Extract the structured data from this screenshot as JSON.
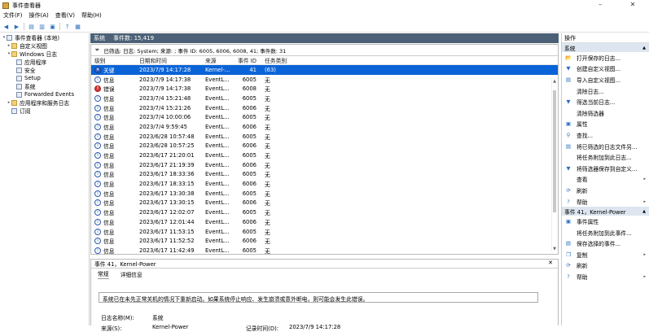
{
  "window": {
    "title": "事件查看器",
    "minimize": "–",
    "close": "✕"
  },
  "menu": [
    "文件(F)",
    "操作(A)",
    "查看(V)",
    "帮助(H)"
  ],
  "tree": [
    {
      "label": "事件查看器 (本地)",
      "level": 0,
      "expander": "▾",
      "icon": "computer-icon"
    },
    {
      "label": "自定义视图",
      "level": 1,
      "expander": "▸",
      "icon": "folder-icon"
    },
    {
      "label": "Windows 日志",
      "level": 1,
      "expander": "▾",
      "icon": "folder-icon"
    },
    {
      "label": "应用程序",
      "level": 2,
      "expander": "",
      "icon": "log-icon"
    },
    {
      "label": "安全",
      "level": 2,
      "expander": "",
      "icon": "log-icon"
    },
    {
      "label": "Setup",
      "level": 2,
      "expander": "",
      "icon": "log-icon"
    },
    {
      "label": "系统",
      "level": 2,
      "expander": "",
      "icon": "log-icon"
    },
    {
      "label": "Forwarded Events",
      "level": 2,
      "expander": "",
      "icon": "log-icon"
    },
    {
      "label": "应用程序和服务日志",
      "level": 1,
      "expander": "▸",
      "icon": "folder-icon"
    },
    {
      "label": "订阅",
      "level": 1,
      "expander": "",
      "icon": "log-icon"
    }
  ],
  "center": {
    "header_name": "系统",
    "header_count": "事件数: 15,419",
    "filter_text": "已筛选: 日志: System; 来源: ; 事件 ID: 6005, 6006, 6008, 41; 事件数: 31",
    "columns": [
      "级别",
      "日期和时间",
      "来源",
      "事件 ID",
      "任务类别"
    ],
    "rows": [
      {
        "level": "关键",
        "type": "crit",
        "datetime": "2023/7/9 14:17:28",
        "source": "Kernel-...",
        "id": "41",
        "task": "(63)",
        "selected": true
      },
      {
        "level": "信息",
        "type": "info",
        "datetime": "2023/7/9 14:17:38",
        "source": "EventL...",
        "id": "6005",
        "task": "无"
      },
      {
        "level": "错误",
        "type": "err",
        "datetime": "2023/7/9 14:17:38",
        "source": "EventL...",
        "id": "6008",
        "task": "无"
      },
      {
        "level": "信息",
        "type": "info",
        "datetime": "2023/7/4 15:21:48",
        "source": "EventL...",
        "id": "6005",
        "task": "无"
      },
      {
        "level": "信息",
        "type": "info",
        "datetime": "2023/7/4 15:21:26",
        "source": "EventL...",
        "id": "6006",
        "task": "无"
      },
      {
        "level": "信息",
        "type": "info",
        "datetime": "2023/7/4 10:00:06",
        "source": "EventL...",
        "id": "6005",
        "task": "无"
      },
      {
        "level": "信息",
        "type": "info",
        "datetime": "2023/7/4 9:59:45",
        "source": "EventL...",
        "id": "6006",
        "task": "无"
      },
      {
        "level": "信息",
        "type": "info",
        "datetime": "2023/6/28 10:57:48",
        "source": "EventL...",
        "id": "6005",
        "task": "无"
      },
      {
        "level": "信息",
        "type": "info",
        "datetime": "2023/6/28 10:57:25",
        "source": "EventL...",
        "id": "6006",
        "task": "无"
      },
      {
        "level": "信息",
        "type": "info",
        "datetime": "2023/6/17 21:20:01",
        "source": "EventL...",
        "id": "6005",
        "task": "无"
      },
      {
        "level": "信息",
        "type": "info",
        "datetime": "2023/6/17 21:19:39",
        "source": "EventL...",
        "id": "6006",
        "task": "无"
      },
      {
        "level": "信息",
        "type": "info",
        "datetime": "2023/6/17 18:33:36",
        "source": "EventL...",
        "id": "6005",
        "task": "无"
      },
      {
        "level": "信息",
        "type": "info",
        "datetime": "2023/6/17 18:33:15",
        "source": "EventL...",
        "id": "6006",
        "task": "无"
      },
      {
        "level": "信息",
        "type": "info",
        "datetime": "2023/6/17 13:30:38",
        "source": "EventL...",
        "id": "6005",
        "task": "无"
      },
      {
        "level": "信息",
        "type": "info",
        "datetime": "2023/6/17 13:30:15",
        "source": "EventL...",
        "id": "6006",
        "task": "无"
      },
      {
        "level": "信息",
        "type": "info",
        "datetime": "2023/6/17 12:02:07",
        "source": "EventL...",
        "id": "6005",
        "task": "无"
      },
      {
        "level": "信息",
        "type": "info",
        "datetime": "2023/6/17 12:01:44",
        "source": "EventL...",
        "id": "6006",
        "task": "无"
      },
      {
        "level": "信息",
        "type": "info",
        "datetime": "2023/6/17 11:53:15",
        "source": "EventL...",
        "id": "6005",
        "task": "无"
      },
      {
        "level": "信息",
        "type": "info",
        "datetime": "2023/6/17 11:52:52",
        "source": "EventL...",
        "id": "6006",
        "task": "无"
      },
      {
        "level": "信息",
        "type": "info",
        "datetime": "2023/6/17 11:42:49",
        "source": "EventL...",
        "id": "6005",
        "task": "无"
      }
    ]
  },
  "detail": {
    "title": "事件 41，Kernel-Power",
    "close": "✕",
    "tabs": [
      "常规",
      "详细信息"
    ],
    "message": "系统已在未先正常关机的情况下重新启动。如果系统停止响应、发生崩溃或意外断电，则可能会发生此错误。",
    "log_name_label": "日志名称(M):",
    "log_name_value": "系统",
    "source_label": "来源(S):",
    "source_value": "Kernel-Power",
    "logged_label": "记录时间(D):",
    "logged_value": "2023/7/9 14:17:28"
  },
  "actions": {
    "title": "操作",
    "section1": "系统",
    "items1": [
      {
        "label": "打开保存的日志...",
        "icon": "folder-open-icon",
        "glyph": "📂"
      },
      {
        "label": "创建自定义视图...",
        "icon": "filter-create-icon",
        "glyph": "▼"
      },
      {
        "label": "导入自定义视图...",
        "icon": "import-icon",
        "glyph": "▤"
      },
      {
        "label": "清除日志...",
        "icon": "clear-log-icon",
        "glyph": ""
      },
      {
        "label": "筛选当前日志...",
        "icon": "filter-icon",
        "glyph": "▼"
      },
      {
        "label": "清除筛选器",
        "icon": "clear-filter-icon",
        "glyph": ""
      },
      {
        "label": "属性",
        "icon": "properties-icon",
        "glyph": "▣"
      },
      {
        "label": "查找...",
        "icon": "find-icon",
        "glyph": "⚲"
      },
      {
        "label": "将已筛选的日志文件另...",
        "icon": "save-icon",
        "glyph": "▤"
      },
      {
        "label": "将任务附加到此日志...",
        "icon": "attach-task-icon",
        "glyph": ""
      },
      {
        "label": "将筛选器保存到自定义...",
        "icon": "save-filter-icon",
        "glyph": "▼"
      },
      {
        "label": "查看",
        "icon": "view-icon",
        "glyph": "",
        "submenu": "▸"
      },
      {
        "label": "刷新",
        "icon": "refresh-icon",
        "glyph": "⟳"
      },
      {
        "label": "帮助",
        "icon": "help-icon",
        "glyph": "?",
        "submenu": "▸"
      }
    ],
    "section2": "事件 41，Kernel-Power",
    "items2": [
      {
        "label": "事件属性",
        "icon": "event-properties-icon",
        "glyph": "▣"
      },
      {
        "label": "将任务附加到此事件...",
        "icon": "attach-event-task-icon",
        "glyph": ""
      },
      {
        "label": "保存选择的事件...",
        "icon": "save-events-icon",
        "glyph": "▤"
      },
      {
        "label": "复制",
        "icon": "copy-icon",
        "glyph": "❐",
        "submenu": "▸"
      },
      {
        "label": "刷新",
        "icon": "refresh-icon",
        "glyph": "⟳"
      },
      {
        "label": "帮助",
        "icon": "help-icon",
        "glyph": "?",
        "submenu": "▸"
      }
    ]
  }
}
